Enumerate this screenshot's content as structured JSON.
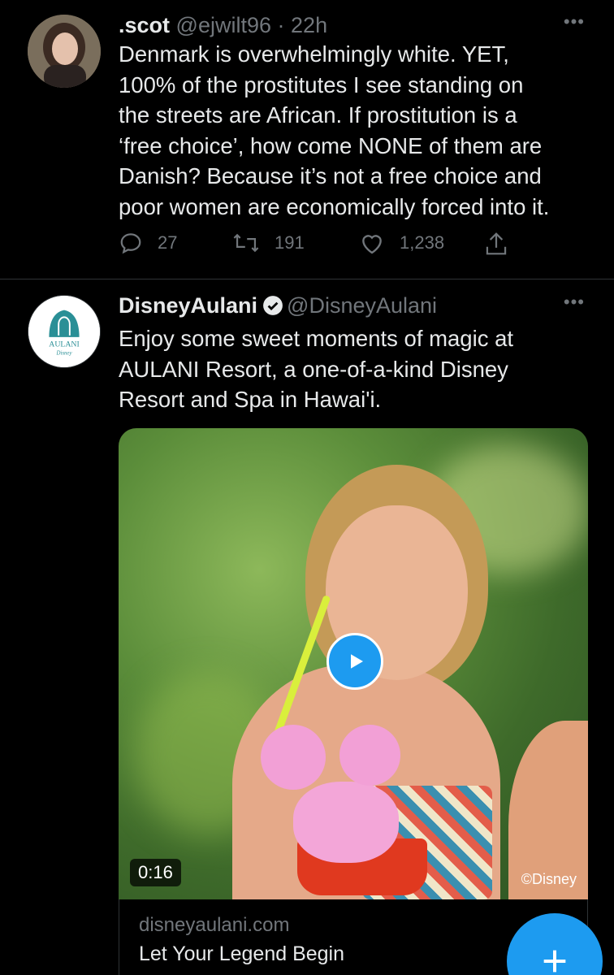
{
  "tweet1": {
    "name": ".scot",
    "handle": "@ejwilt96",
    "separator": "·",
    "time": "22h",
    "more": "•••",
    "text": "Denmark is overwhelmingly white. YET,\n100% of the prostitutes I see standing on\nthe streets are African. If prostitution is a\n‘free choice’, how come NONE of them are\nDanish? Because it’s not a free choice and\npoor women are economically forced into it.",
    "replies": "27",
    "retweets": "191",
    "likes": "1,238"
  },
  "tweet2": {
    "name": "DisneyAulani",
    "handle": "@DisneyAulani",
    "more": "•••",
    "avatar_logo_top": "AULANI",
    "avatar_logo_bottom": "Disney",
    "text": "Enjoy some sweet moments of magic at\nAULANI Resort, a one-of-a-kind Disney\nResort and Spa in Hawai'i.",
    "video_duration": "0:16",
    "copyright": "©Disney",
    "card_domain": "disneyaulani.com",
    "card_title": "Let Your Legend Begin"
  },
  "colors": {
    "background": "#000000",
    "text": "#e7e9ea",
    "muted": "#71767b",
    "accent": "#1d9bf0"
  },
  "icons": [
    "more-icon",
    "reply-icon",
    "retweet-icon",
    "like-icon",
    "share-icon",
    "verified-icon",
    "play-icon",
    "compose-plus-icon"
  ]
}
